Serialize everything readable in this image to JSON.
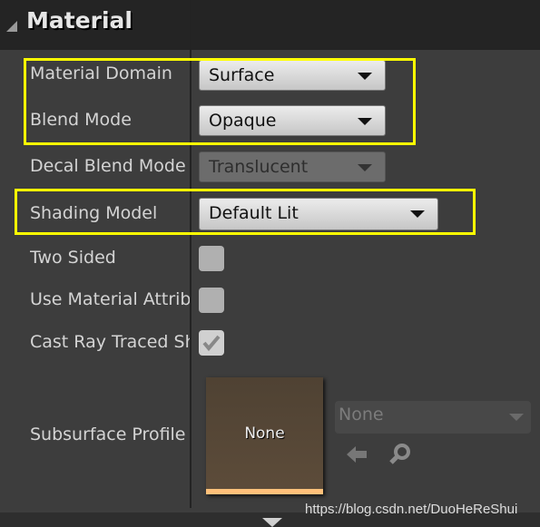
{
  "section": {
    "title": "Material"
  },
  "properties": [
    {
      "label": "Material Domain",
      "value": "Surface"
    },
    {
      "label": "Blend Mode",
      "value": "Opaque"
    },
    {
      "label": "Decal Blend Mode",
      "value": "Translucent",
      "disabled": true
    },
    {
      "label": "Shading Model",
      "value": "Default Lit"
    },
    {
      "label": "Two Sided",
      "checked": false
    },
    {
      "label": "Use Material Attributes",
      "checked": false
    },
    {
      "label": "Cast Ray Traced Shadows",
      "checked": true
    },
    {
      "label": "Subsurface Profile",
      "thumbnail": "None",
      "asset": "None"
    }
  ],
  "highlight_color": "#ffff00",
  "watermark": "https://blog.csdn.net/DuoHeReShui"
}
